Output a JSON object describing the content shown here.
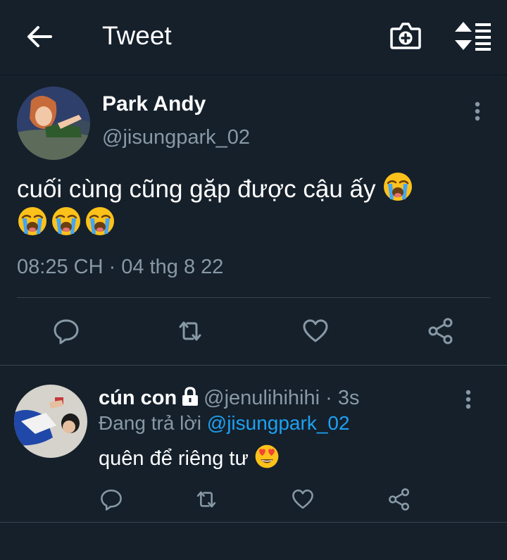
{
  "header": {
    "title": "Tweet",
    "back_icon": "arrow-left-icon",
    "camera_icon": "camera-plus-icon",
    "sort_icon": "sort-list-icon"
  },
  "tweet": {
    "name": "Park Andy",
    "handle": "@jisungpark_02",
    "text": "cuối cùng cũng gặp được cậu ấy",
    "emoji": "loudly-crying-face",
    "timestamp": "08:25 CH · 04 thg 8 22",
    "actions": [
      "reply-icon",
      "retweet-icon",
      "like-icon",
      "share-icon"
    ]
  },
  "reply": {
    "name": "cún con",
    "handle": "@jenulihihihi",
    "time": "· 3s",
    "replying_prefix": "Đang trả lời",
    "replying_to": "@jisungpark_02",
    "text": "quên để riêng tư",
    "emoji": "smiling-face-with-heart-eyes",
    "actions": [
      "reply-icon",
      "retweet-icon",
      "like-icon",
      "share-icon"
    ]
  },
  "colors": {
    "background": "#15202b",
    "secondary_text": "#8899a6",
    "link": "#1da1f2",
    "divider": "#38444d"
  }
}
